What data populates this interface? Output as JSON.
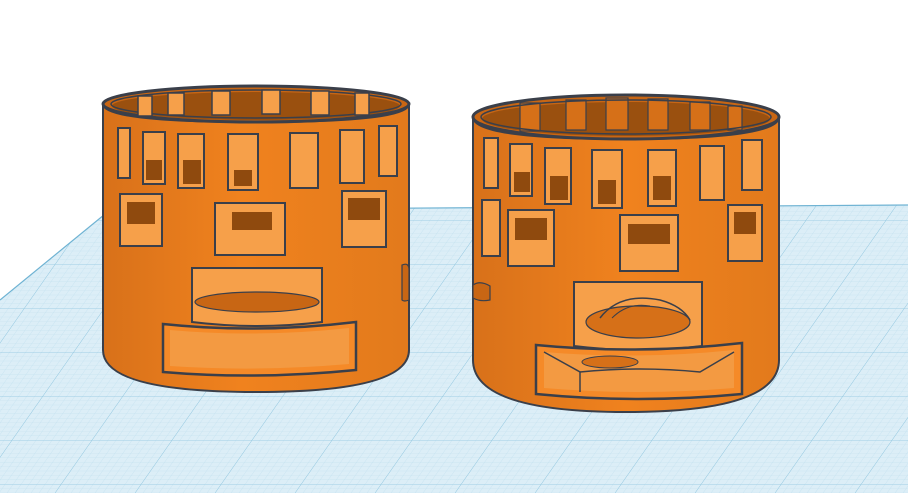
{
  "viewport": {
    "background": "#ffffff",
    "workplane_color": "#dceef7",
    "grid_minor_color": "#b9dcec",
    "grid_major_color": "#8cc4de",
    "edge_color": "#2f4a5e"
  },
  "objects": [
    {
      "name": "cylinder-holder-left",
      "color": "#f0821e",
      "shade": "#c86614",
      "dark": "#8f4a0e",
      "outline": "#3a3f4a"
    },
    {
      "name": "cylinder-holder-right",
      "color": "#f0821e",
      "shade": "#c86614",
      "dark": "#8f4a0e",
      "outline": "#3a3f4a"
    }
  ]
}
